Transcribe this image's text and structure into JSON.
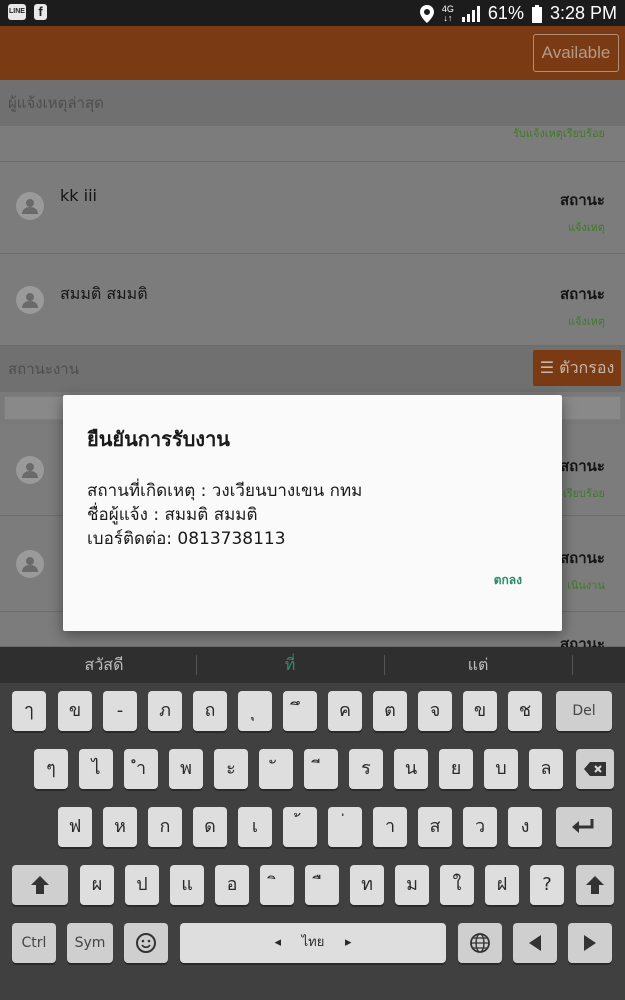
{
  "status_bar": {
    "left_icons": [
      "line-app-icon",
      "facebook-icon"
    ],
    "battery": "61%",
    "time": "3:28 PM",
    "network": "4G"
  },
  "app_bar": {
    "available_label": "Available"
  },
  "latest_reporters": {
    "header": "ผู้แจ้งเหตุล่าสุด",
    "top_status": "รับแจ้งเหตุเรียบร้อย",
    "rows": [
      {
        "name": "kk iii",
        "status": "สถานะ",
        "sub": "แจ้งเหตุ"
      },
      {
        "name": "สมมติ สมมติ",
        "status": "สถานะ",
        "sub": "แจ้งเหตุ"
      }
    ]
  },
  "work_status": {
    "header": "สถานะงาน",
    "filter_label": "ตัวกรอง",
    "rows": [
      {
        "status": "สถานะ",
        "sub": "เรียบร้อย"
      },
      {
        "status": "สถานะ",
        "sub": "เนินงาน"
      },
      {
        "status": "สถานะ",
        "sub": ""
      }
    ]
  },
  "dialog": {
    "title": "ยืนยันการรับงาน",
    "location": "สถานที่เกิดเหตุ : วงเวียนบางเขน กทม",
    "reporter": "ชื่อผู้แจ้ง : สมมติ สมมติ",
    "phone": "เบอร์ติดต่อ: 0813738113",
    "ok_label": "ตกลง"
  },
  "keyboard": {
    "suggestions": [
      "สวัสดี",
      "ที่",
      "แต่"
    ],
    "row1": [
      "ๅ",
      "ข",
      "-",
      "ภ",
      "ถ",
      "ุ",
      "ึ",
      "ค",
      "ต",
      "จ",
      "ข",
      "ช",
      "Del"
    ],
    "row2": [
      "ๆ",
      "ไ",
      "ำ",
      "พ",
      "ะ",
      "ั",
      "ี",
      "ร",
      "น",
      "ย",
      "บ",
      "ล"
    ],
    "row3": [
      "ฟ",
      "ห",
      "ก",
      "ด",
      "เ",
      "้",
      "่",
      "า",
      "ส",
      "ว",
      "ง"
    ],
    "row4": [
      "ผ",
      "ป",
      "แ",
      "อ",
      "ิ",
      "ื",
      "ท",
      "ม",
      "ใ",
      "ฝ",
      "?"
    ],
    "row5": {
      "ctrl": "Ctrl",
      "sym": "Sym",
      "lang": "ไทย"
    }
  }
}
